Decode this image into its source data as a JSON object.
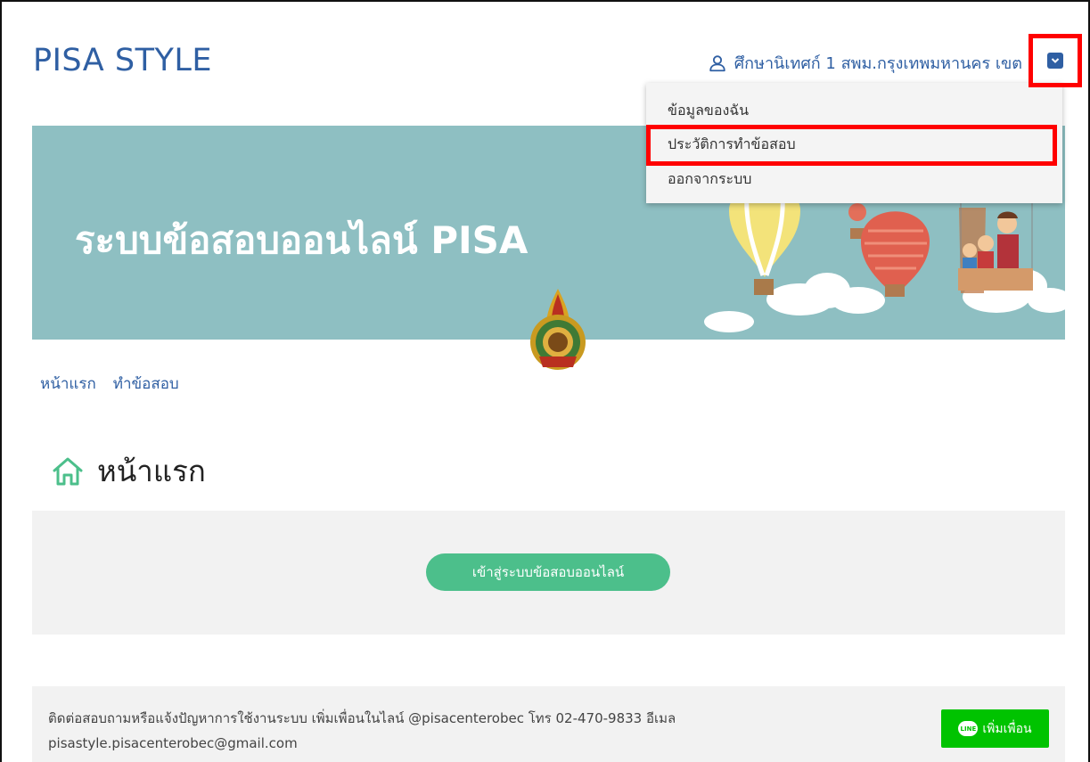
{
  "header": {
    "brand": "PISA STYLE",
    "user_name": "ศึกษานิเทศก์ 1 สพม.กรุงเทพมหานคร เขต"
  },
  "dropdown": {
    "items": [
      {
        "label": "ข้อมูลของฉัน"
      },
      {
        "label": "ประวัติการทำข้อสอบ"
      },
      {
        "label": "ออกจากระบบ"
      }
    ]
  },
  "banner": {
    "title": "ระบบข้อสอบออนไลน์ PISA"
  },
  "nav": {
    "items": [
      {
        "label": "หน้าแรก"
      },
      {
        "label": "ทำข้อสอบ"
      }
    ]
  },
  "page": {
    "title": "หน้าแรก",
    "cta_label": "เข้าสู่ระบบข้อสอบออนไลน์"
  },
  "footer": {
    "text": "ติดต่อสอบถามหรือแจ้งปัญหาการใช้งานระบบ เพิ่มเพื่อนในไลน์ @pisacenterobec โทร 02-470-9833 อีเมล pisastyle.pisacenterobec@gmail.com",
    "line_badge": "LINE",
    "line_label": "เพิ่มเพื่อน"
  },
  "colors": {
    "brand_blue": "#2f5fa3",
    "banner_bg": "#8ebfc2",
    "cta_green": "#4cbf8b",
    "line_green": "#00c300",
    "highlight_red": "#ff0000"
  },
  "icons": {
    "user": "user-icon",
    "dropdown": "chevron-down-icon",
    "home": "home-icon",
    "line": "line-logo-icon"
  }
}
